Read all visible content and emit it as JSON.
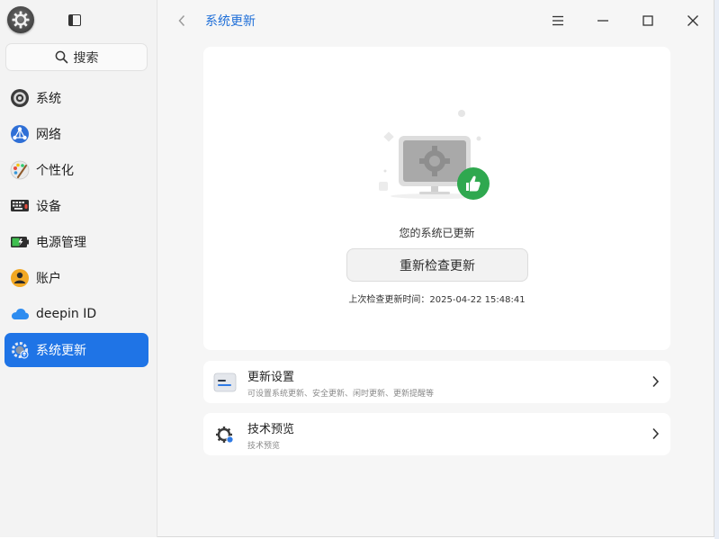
{
  "window": {
    "title": "系统更新"
  },
  "sidebar": {
    "search_label": "搜索",
    "items": [
      {
        "label": "系统",
        "icon": "system-icon",
        "active": false
      },
      {
        "label": "网络",
        "icon": "network-icon",
        "active": false
      },
      {
        "label": "个性化",
        "icon": "personalization-icon",
        "active": false
      },
      {
        "label": "设备",
        "icon": "device-icon",
        "active": false
      },
      {
        "label": "电源管理",
        "icon": "power-icon",
        "active": false
      },
      {
        "label": "账户",
        "icon": "account-icon",
        "active": false
      },
      {
        "label": "deepin ID",
        "icon": "cloud-icon",
        "active": false
      },
      {
        "label": "系统更新",
        "icon": "update-icon",
        "active": true
      }
    ]
  },
  "status": {
    "message": "您的系统已更新",
    "recheck_label": "重新检查更新",
    "last_check": "上次检查更新时间：2025-04-22 15:48:41"
  },
  "settings": [
    {
      "title": "更新设置",
      "subtitle": "可设置系统更新、安全更新、闲时更新、更新提醒等",
      "icon": "update-settings-icon"
    },
    {
      "title": "技术预览",
      "subtitle": "技术预览",
      "icon": "tech-preview-icon"
    }
  ],
  "colors": {
    "accent": "#1f74e6",
    "title": "#1f6fd8",
    "success": "#2fa84f"
  }
}
